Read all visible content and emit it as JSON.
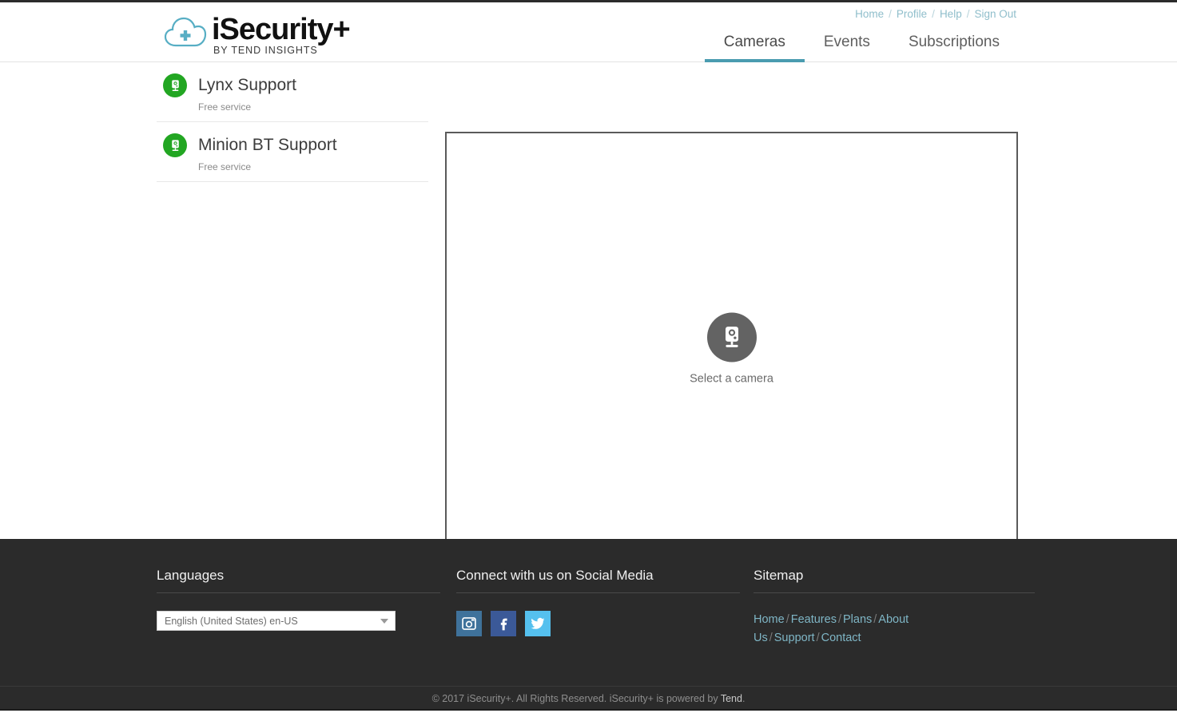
{
  "brand": {
    "title": "iSecurity+",
    "subtitle": "BY TEND INSIGHTS",
    "logo_icon": "cloud-plus-icon",
    "accent_color": "#4a9cb0"
  },
  "header": {
    "util_links": [
      {
        "label": "Home",
        "name": "home"
      },
      {
        "label": "Profile",
        "name": "profile"
      },
      {
        "label": "Help",
        "name": "help"
      },
      {
        "label": "Sign Out",
        "name": "sign-out"
      }
    ],
    "separator": "/",
    "tabs": [
      {
        "label": "Cameras",
        "active": true
      },
      {
        "label": "Events",
        "active": false
      },
      {
        "label": "Subscriptions",
        "active": false
      }
    ]
  },
  "cameras": [
    {
      "name": "Lynx Support",
      "service": "Free service",
      "status_color": "#22a622",
      "icon": "camera-icon"
    },
    {
      "name": "Minion BT Support",
      "service": "Free service",
      "status_color": "#22a622",
      "icon": "camera-icon"
    }
  ],
  "viewer": {
    "placeholder_label": "Select a camera",
    "placeholder_icon": "camera-icon"
  },
  "footer": {
    "languages": {
      "title": "Languages",
      "selected": "English (United States) en-US"
    },
    "social": {
      "title": "Connect with us on Social Media",
      "items": [
        {
          "name": "instagram",
          "color": "#3f729b"
        },
        {
          "name": "facebook",
          "color": "#3b5998"
        },
        {
          "name": "twitter",
          "color": "#55c0ee"
        }
      ]
    },
    "sitemap": {
      "title": "Sitemap",
      "links": [
        "Home",
        "Features",
        "Plans",
        "About Us",
        "Support",
        "Contact"
      ],
      "separator": "/"
    },
    "copyright_prefix": "© 2017 iSecurity+. All Rights Reserved. iSecurity+ is powered by ",
    "copyright_brand": "Tend",
    "copyright_suffix": "."
  }
}
